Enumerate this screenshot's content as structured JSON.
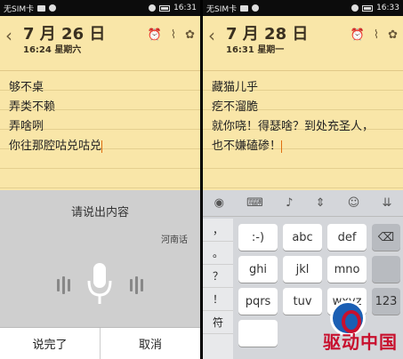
{
  "left": {
    "status": {
      "carrier": "无SIM卡",
      "time": "16:31"
    },
    "note": {
      "date": "7 月 26 日",
      "time": "16:24 星期六",
      "lines": [
        "够不桌",
        "弄类不赖",
        "弄啥咧",
        "你往那腔咕兑咕兑"
      ]
    },
    "voice": {
      "title": "请说出内容",
      "dialect": "河南话",
      "done": "说完了",
      "cancel": "取消"
    }
  },
  "right": {
    "status": {
      "carrier": "无SIM卡",
      "time": "16:33"
    },
    "note": {
      "date": "7 月 28 日",
      "time": "16:31 星期一",
      "lines": [
        "藏猫儿乎",
        "疙不溜脆",
        "就你哓！得瑟啥？到处充圣人，",
        "也不嫌磕碜！"
      ]
    },
    "keyboard": {
      "symbols": [
        "，",
        "。",
        "？",
        "！",
        "符"
      ],
      "row1": [
        ":-)",
        "abc",
        "def"
      ],
      "row2": [
        "ghi",
        "jkl",
        "mno"
      ],
      "row3": [
        "pqrs",
        "tuv",
        "wxyz"
      ],
      "num_key": "123",
      "delete_icon": "backspace-icon"
    },
    "watermark": "驱动中国"
  }
}
